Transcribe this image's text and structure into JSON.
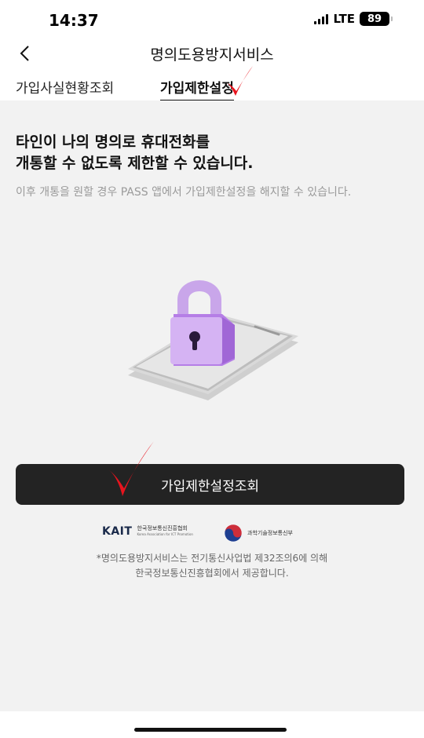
{
  "status_bar": {
    "time": "14:37",
    "network": "LTE",
    "battery": "89"
  },
  "header": {
    "title": "명의도용방지서비스",
    "back_icon": "chevron-left-icon"
  },
  "tabs": [
    {
      "label": "가입사실현황조회",
      "active": false
    },
    {
      "label": "가입제한설정",
      "active": true
    }
  ],
  "main": {
    "headline_line1": "타인이 나의 명의로 휴대전화를",
    "headline_line2": "개통할 수 없도록 제한할 수 있습니다.",
    "subtext": "이후 개통을 원할 경우 PASS 앱에서 가입제한설정을 해지할 수 있습니다.",
    "illustration_icon": "lock-phone-icon"
  },
  "primary_button": {
    "label": "가입제한설정조회"
  },
  "logos": {
    "kait_mark": "KAIT",
    "kait_name": "한국정보통신진흥협회",
    "kait_english": "Korea Association for ICT Promotion",
    "msit_name": "과학기술정보통신부"
  },
  "footnote": {
    "line1": "*명의도용방지서비스는 전기통신사업법 제32조의6에 의해",
    "line2": "한국정보통신진흥협회에서 제공합니다."
  },
  "annotations": {
    "check_color": "#e8141e"
  }
}
